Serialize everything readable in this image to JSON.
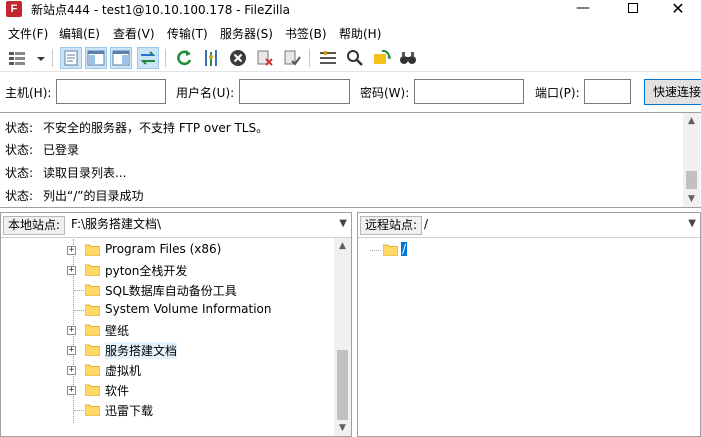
{
  "window": {
    "title": "新站点444 - test1@10.10.100.178 - FileZilla",
    "app_icon_glyph": "F",
    "minimize_glyph": "—",
    "close_glyph": "✕"
  },
  "menu": {
    "items": [
      "文件(F)",
      "编辑(E)",
      "查看(V)",
      "传输(T)",
      "服务器(S)",
      "书签(B)",
      "帮助(H)"
    ]
  },
  "toolbar": {
    "icons": [
      "site-manager-icon",
      "dropdown-arrow-icon",
      "toggle-message-log-icon",
      "toggle-local-tree-icon",
      "toggle-remote-tree-icon",
      "toggle-transfer-queue-icon",
      "refresh-icon",
      "process-queue-icon",
      "cancel-icon",
      "disconnect-icon",
      "reconnect-icon",
      "filter-icon",
      "compare-icon",
      "sync-browse-icon",
      "search-icon"
    ]
  },
  "quickconnect": {
    "host_label": "主机(H):",
    "user_label": "用户名(U):",
    "pass_label": "密码(W):",
    "port_label": "端口(P):",
    "host_value": "",
    "user_value": "",
    "pass_value": "",
    "port_value": "",
    "button_label": "快速连接"
  },
  "log": {
    "lines": [
      {
        "label": "状态:",
        "text": "不安全的服务器，不支持 FTP over TLS。"
      },
      {
        "label": "状态:",
        "text": "已登录"
      },
      {
        "label": "状态:",
        "text": "读取目录列表..."
      },
      {
        "label": "状态:",
        "text": "列出“/”的目录成功"
      }
    ]
  },
  "local": {
    "site_label": "本地站点:",
    "path": "F:\\服务搭建文档\\",
    "tree": [
      {
        "name": "Program Files (x86)",
        "expandable": true
      },
      {
        "name": "pyton全栈开发",
        "expandable": true
      },
      {
        "name": "SQL数据库自动备份工具",
        "expandable": false
      },
      {
        "name": "System Volume Information",
        "expandable": false
      },
      {
        "name": "壁纸",
        "expandable": true
      },
      {
        "name": "服务搭建文档",
        "expandable": true,
        "selected": true
      },
      {
        "name": "虚拟机",
        "expandable": true
      },
      {
        "name": "软件",
        "expandable": true
      },
      {
        "name": "迅雷下载",
        "expandable": false
      }
    ]
  },
  "remote": {
    "site_label": "远程站点:",
    "path": "/",
    "tree": [
      {
        "name": "/",
        "selected": true
      }
    ]
  },
  "colors": {
    "folder": "#ffd866",
    "selection": "#0078d7",
    "accent_button_border": "#0078d7"
  }
}
